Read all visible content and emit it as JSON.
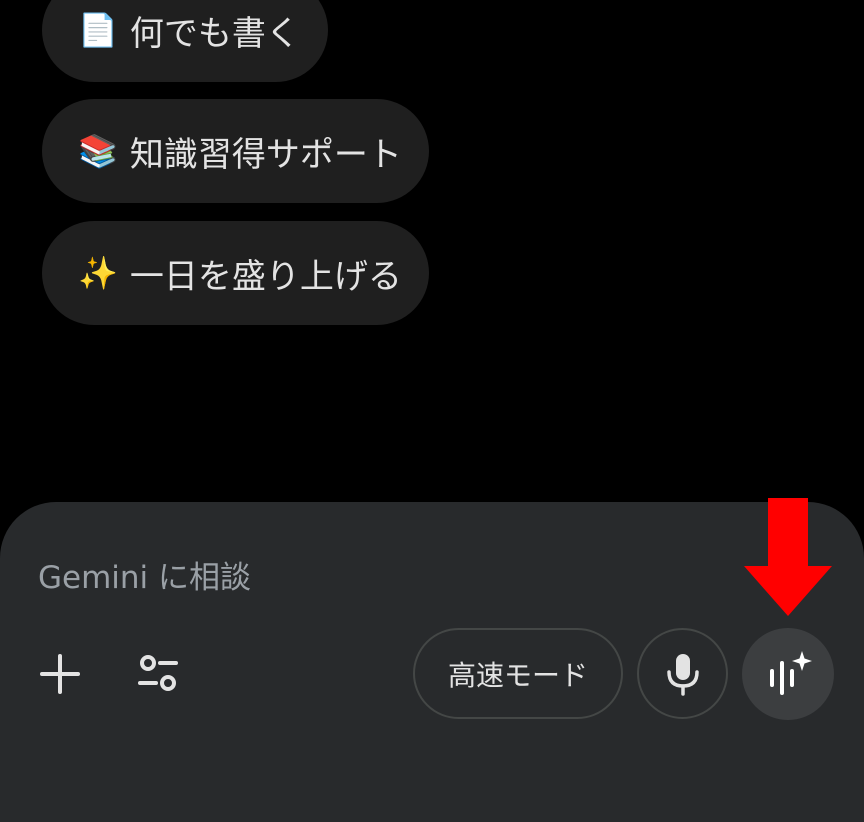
{
  "suggestions": [
    {
      "emoji": "📄",
      "label": "何でも書く"
    },
    {
      "emoji": "📚",
      "label": "知識習得サポート"
    },
    {
      "emoji": "✨",
      "label": "一日を盛り上げる"
    }
  ],
  "composer": {
    "placeholder": "Gemini に相談",
    "mode_label": "高速モード"
  },
  "icons": {
    "add": "plus-icon",
    "tools": "tools-sliders-icon",
    "mic": "microphone-icon",
    "live": "gemini-live-icon",
    "annotation": "red-down-arrow"
  },
  "colors": {
    "background": "#000000",
    "chip": "#1f1f1f",
    "composer": "#282a2c",
    "annotation_arrow": "#ff0000"
  }
}
